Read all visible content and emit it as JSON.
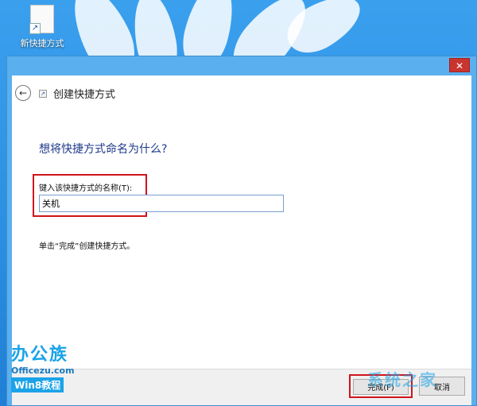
{
  "desktop": {
    "icon_label": "新快捷方式"
  },
  "window": {
    "close_glyph": "✕",
    "nav": {
      "back_glyph": "←",
      "title": "创建快捷方式"
    },
    "heading": "想将快捷方式命名为什么?",
    "field_label": "键入该快捷方式的名称(T):",
    "field_value": "关机",
    "hint": "单击“完成”创建快捷方式。",
    "buttons": {
      "finish": "完成(F)",
      "cancel": "取消"
    }
  },
  "watermarks": {
    "logo_text": "办公族",
    "logo_site": "Officezu.com",
    "logo_tag": "Win8教程",
    "right_text": "系统之家"
  },
  "colors": {
    "accent_red": "#d0141c",
    "title_blue": "#1f3a8a",
    "window_frame": "#5ab0ef",
    "close_red": "#c9342f"
  }
}
